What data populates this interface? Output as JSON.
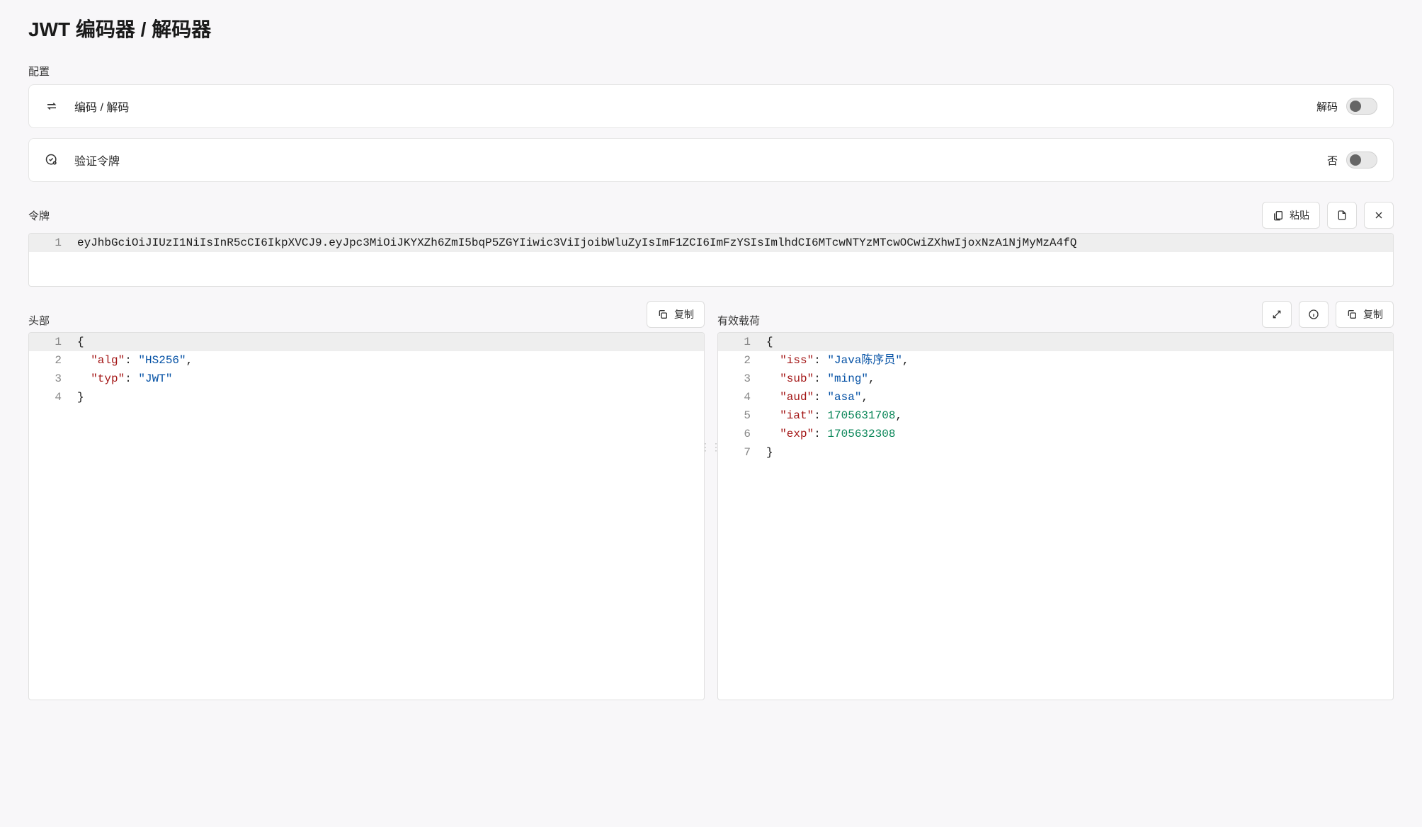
{
  "title": "JWT 编码器 / 解码器",
  "config": {
    "section_label": "配置",
    "encode_decode": {
      "label": "编码 / 解码",
      "value_label": "解码"
    },
    "verify_token": {
      "label": "验证令牌",
      "value_label": "否"
    }
  },
  "token": {
    "section_label": "令牌",
    "paste_label": "粘贴",
    "value": "eyJhbGciOiJIUzI1NiIsInR5cCI6IkpXVCJ9.eyJpc3MiOiJKYXZh6ZmI5bqP5ZGYIiwic3ViIjoibWluZyIsImF1ZCI6ImFzYSIsImlhdCI6MTcwNTYzMTcwOCwiZXhwIjoxNzA1NjMyMzA4fQ"
  },
  "header": {
    "section_label": "头部",
    "copy_label": "复制",
    "json": {
      "alg": "HS256",
      "typ": "JWT"
    }
  },
  "payload": {
    "section_label": "有效载荷",
    "copy_label": "复制",
    "json": {
      "iss": "Java陈序员",
      "sub": "ming",
      "aud": "asa",
      "iat": 1705631708,
      "exp": 1705632308
    }
  }
}
